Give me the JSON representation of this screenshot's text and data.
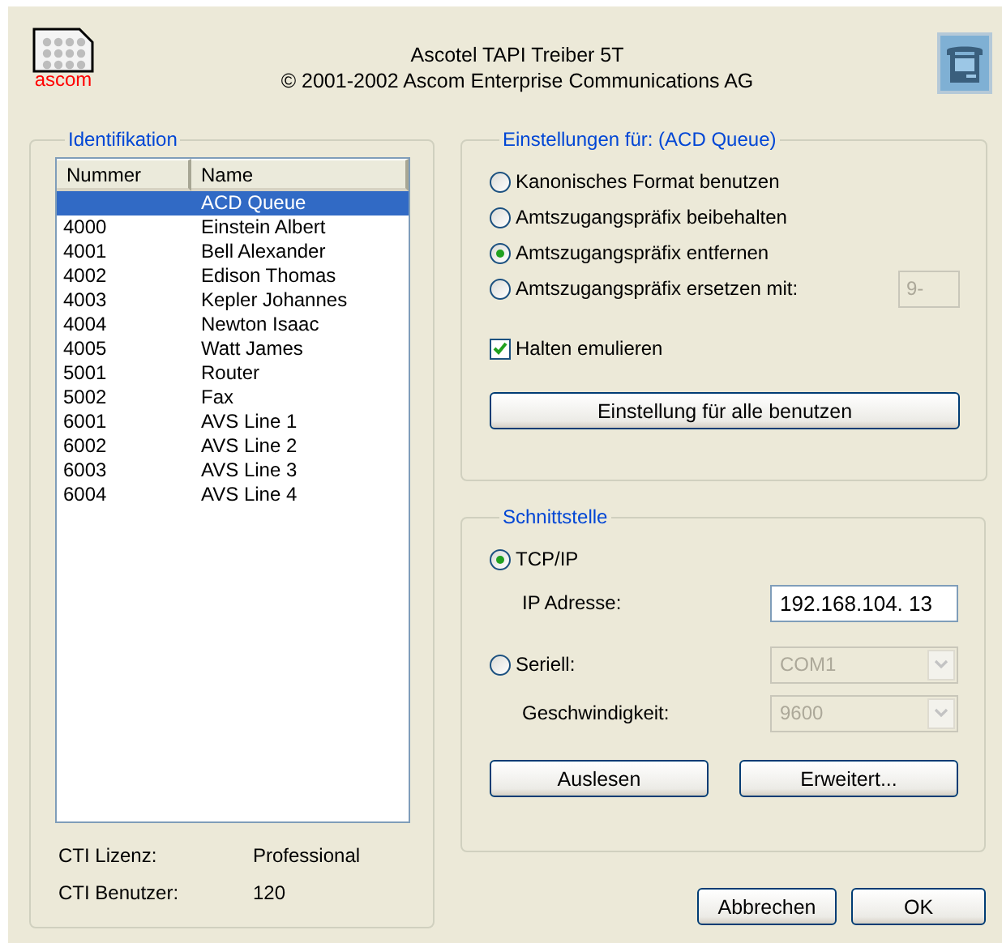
{
  "header": {
    "logo_text": "ascom",
    "title": "Ascotel TAPI Treiber 5T",
    "copyright": "© 2001-2002 Ascom Enterprise Communications AG"
  },
  "identification": {
    "title": "Identifikation",
    "columns": [
      "Nummer",
      "Name"
    ],
    "rows": [
      {
        "number": "",
        "name": "ACD Queue",
        "selected": true
      },
      {
        "number": "4000",
        "name": "Einstein Albert",
        "selected": false
      },
      {
        "number": "4001",
        "name": "Bell Alexander",
        "selected": false
      },
      {
        "number": "4002",
        "name": "Edison Thomas",
        "selected": false
      },
      {
        "number": "4003",
        "name": "Kepler Johannes",
        "selected": false
      },
      {
        "number": "4004",
        "name": "Newton Isaac",
        "selected": false
      },
      {
        "number": "4005",
        "name": "Watt James",
        "selected": false
      },
      {
        "number": "5001",
        "name": "Router",
        "selected": false
      },
      {
        "number": "5002",
        "name": "Fax",
        "selected": false
      },
      {
        "number": "6001",
        "name": "AVS Line 1",
        "selected": false
      },
      {
        "number": "6002",
        "name": "AVS Line 2",
        "selected": false
      },
      {
        "number": "6003",
        "name": "AVS Line 3",
        "selected": false
      },
      {
        "number": "6004",
        "name": "AVS Line 4",
        "selected": false
      }
    ],
    "info": [
      {
        "label": "CTI Lizenz:",
        "value": "Professional"
      },
      {
        "label": "CTI Benutzer:",
        "value": "120"
      }
    ]
  },
  "settings": {
    "title": "Einstellungen für:  (ACD Queue)",
    "options": [
      {
        "label": "Kanonisches Format benutzen",
        "selected": false
      },
      {
        "label": "Amtszugangspräfix beibehalten",
        "selected": false
      },
      {
        "label": "Amtszugangspräfix entfernen",
        "selected": true
      },
      {
        "label": "Amtszugangspräfix ersetzen mit:",
        "selected": false,
        "field": {
          "value": "9-",
          "disabled": true
        }
      }
    ],
    "hold": {
      "label": "Halten emulieren",
      "checked": true
    },
    "apply_button": "Einstellung für alle benutzen"
  },
  "interface": {
    "title": "Schnittstelle",
    "tcp": {
      "label": "TCP/IP",
      "selected": true
    },
    "ip": {
      "label": "IP Adresse:",
      "value": "192.168.104. 13"
    },
    "serial": {
      "label": "Seriell:",
      "selected": false,
      "value": "COM1",
      "disabled": true
    },
    "speed": {
      "label": "Geschwindigkeit:",
      "value": "9600",
      "disabled": true
    },
    "buttons": [
      "Auslesen",
      "Erweitert..."
    ]
  },
  "buttons": [
    "Abbrechen",
    "OK"
  ]
}
